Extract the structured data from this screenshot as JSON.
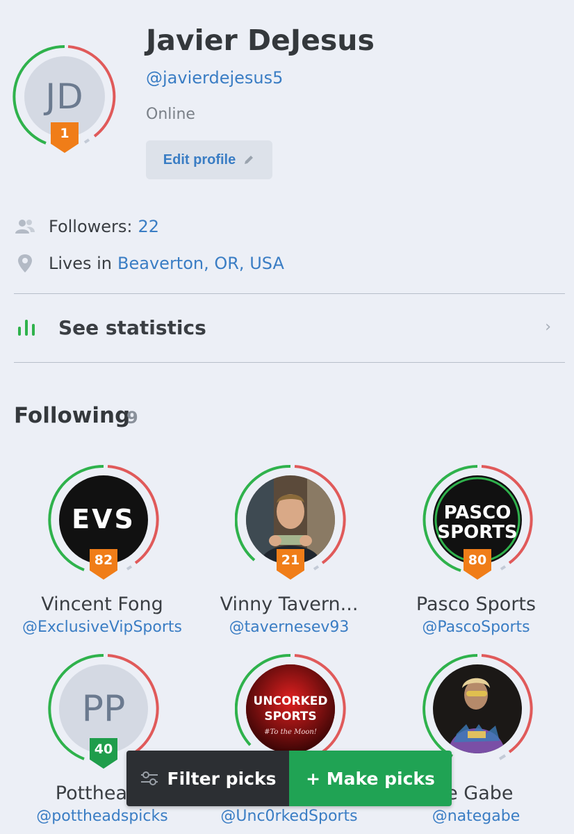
{
  "profile": {
    "initials": "JD",
    "name": "Javier DeJesus",
    "handle": "@javierdejesus5",
    "status": "Online",
    "rank": "1",
    "edit_label": "Edit profile"
  },
  "info": {
    "followers_label": "Followers:",
    "followers_count": "22",
    "lives_label": "Lives in",
    "location": "Beaverton, OR, USA"
  },
  "statistics": {
    "label": "See statistics"
  },
  "following": {
    "title": "Following",
    "count": "9",
    "items": [
      {
        "name": "Vincent Fong",
        "handle": "@ExclusiveVipSports",
        "score": "82",
        "logo_text": "EVS"
      },
      {
        "name": "Vinny Tavern...",
        "handle": "@tavernesev93",
        "score": "21"
      },
      {
        "name": "Pasco Sports",
        "handle": "@PascoSports",
        "score": "80",
        "logo_line1": "PASCO",
        "logo_line2": "SPORTS"
      },
      {
        "name": "Pottheads",
        "handle": "@pottheadspicks",
        "score": "40",
        "initials": "PP"
      },
      {
        "name": "",
        "handle": "@Unc0rkedSports",
        "score": "",
        "logo_line1": "UNCORKED",
        "logo_line2": "SPORTS",
        "logo_line3": "#To the Moon!"
      },
      {
        "name": "te Gabe",
        "handle": "@nategabe",
        "score": ""
      }
    ]
  },
  "bottom_bar": {
    "filter_label": "Filter picks",
    "make_label": "+ Make picks"
  },
  "colors": {
    "accent_blue": "#3a7dc4",
    "ring_green": "#2fb24c",
    "ring_red": "#e05a5a",
    "badge_orange": "#f07d18",
    "badge_green": "#1f9d4b",
    "action_green": "#20a354"
  }
}
